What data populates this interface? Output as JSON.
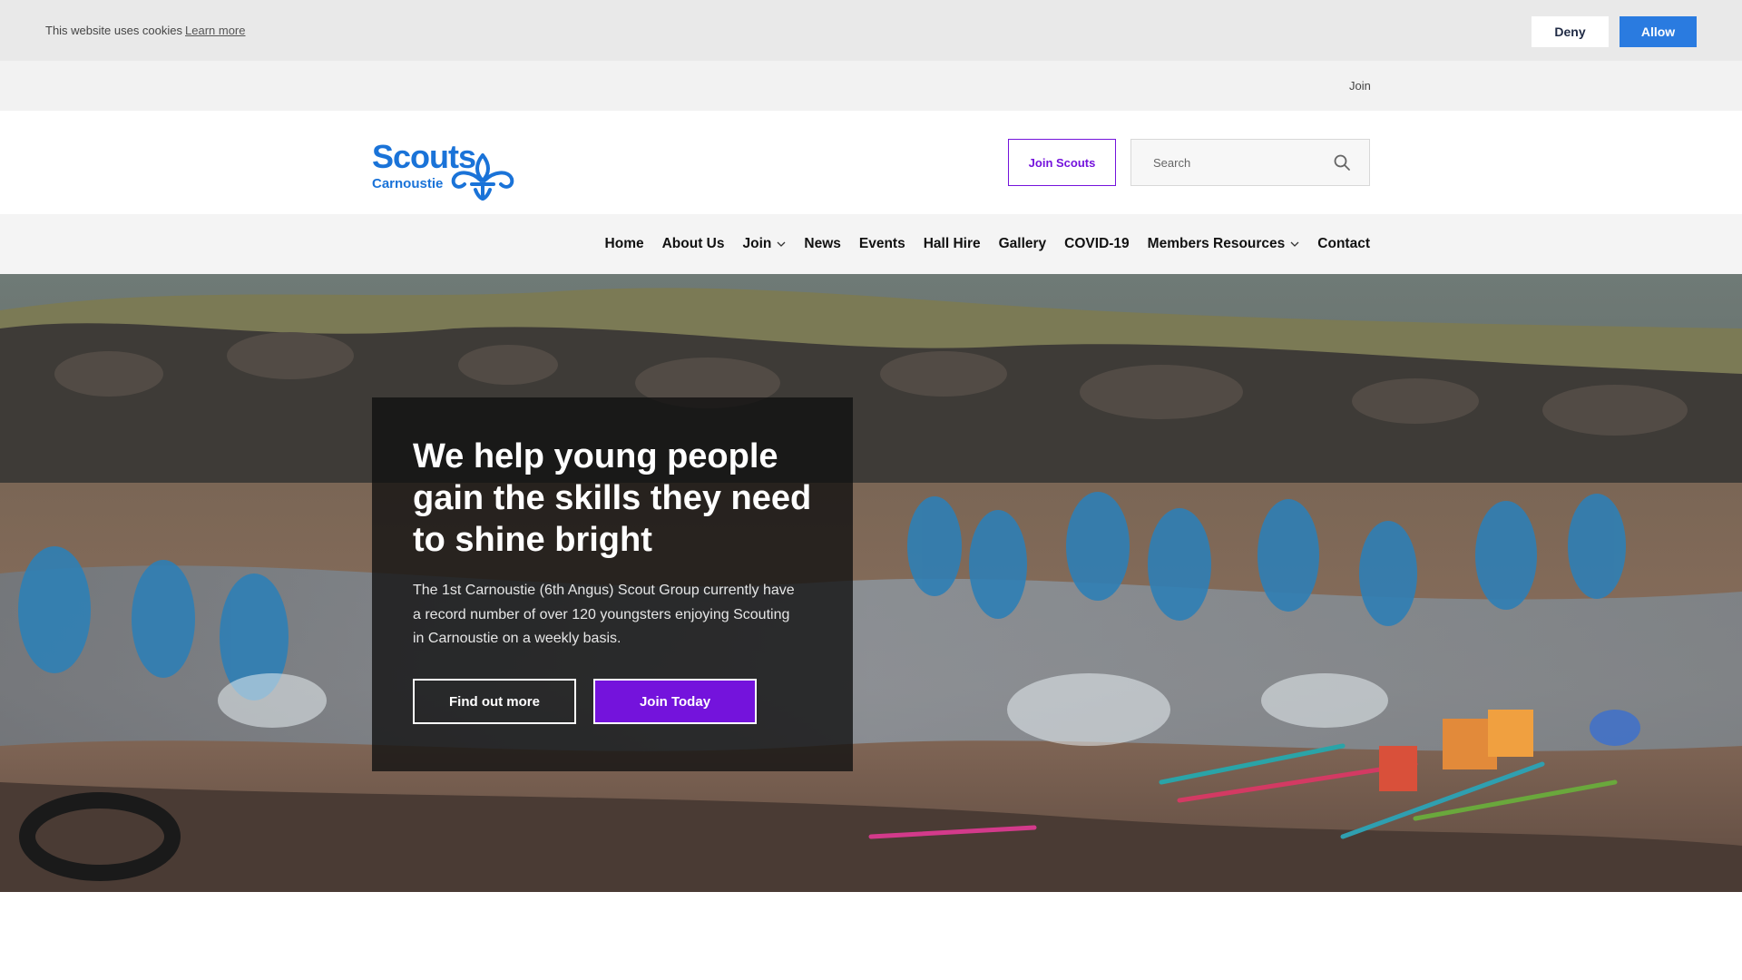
{
  "cookie_bar": {
    "message": "This website uses cookies",
    "learn_more": "Learn more",
    "deny_label": "Deny",
    "allow_label": "Allow",
    "allow_color": "#2a7be0"
  },
  "utility_bar": {
    "join_label": "Join"
  },
  "header": {
    "logo_word": "Scouts",
    "logo_subtitle": "Carnoustie",
    "logo_icon": "fleur-de-lis-icon",
    "join_button_label": "Join Scouts",
    "search_placeholder": "Search",
    "search_icon": "search-icon",
    "brand_color": "#1a73d8",
    "accent_color": "#7413dc"
  },
  "nav": {
    "items": [
      {
        "label": "Home",
        "dropdown": false
      },
      {
        "label": "About Us",
        "dropdown": false
      },
      {
        "label": "Join",
        "dropdown": true
      },
      {
        "label": "News",
        "dropdown": false
      },
      {
        "label": "Events",
        "dropdown": false
      },
      {
        "label": "Hall Hire",
        "dropdown": false
      },
      {
        "label": "Gallery",
        "dropdown": false
      },
      {
        "label": "COVID-19",
        "dropdown": false
      },
      {
        "label": "Members Resources",
        "dropdown": true
      },
      {
        "label": "Contact",
        "dropdown": false
      }
    ]
  },
  "hero": {
    "title": "We help young people gain the skills they need to shine bright",
    "body": "The 1st Carnoustie (6th Angus) Scout Group currently have a record number of over 120 youngsters enjoying Scouting in Carnoustie on a weekly basis.",
    "find_out_more_label": "Find out more",
    "join_today_label": "Join Today"
  }
}
